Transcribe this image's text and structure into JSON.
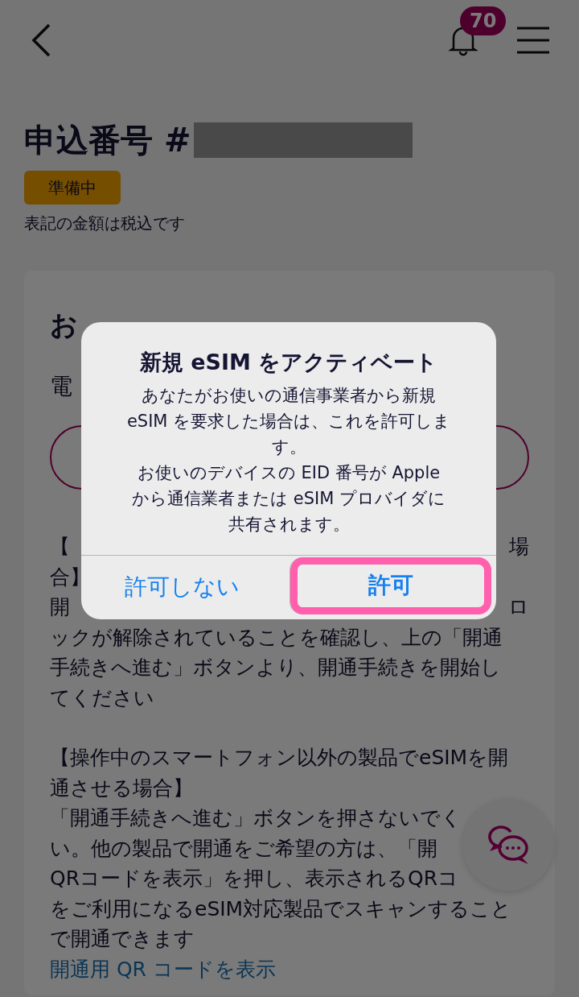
{
  "header": {
    "notification_count": "70"
  },
  "page_title": "申込番号 #",
  "status_badge": "準備中",
  "tax_note": "表記の金額は税込です",
  "card": {
    "title_fragment": "お",
    "label_fragment": "電",
    "paragraphs": [
      [
        {
          "left": "【",
          "right": "場"
        },
        {
          "left": "合】"
        },
        {
          "left": "開",
          "right": "ロ"
        },
        {
          "left": "ックが解除されていることを確認し、上の「開通"
        },
        {
          "left": "手続きへ進む」ボタンより、開通手続きを開始し"
        },
        {
          "left": "てください"
        }
      ],
      [
        {
          "left": "【操作中のスマートフォン以外の製品でeSIMを開"
        },
        {
          "left": "通させる場合】"
        },
        {
          "left": "「開通手続きへ進む」ボタンを押さないでく"
        },
        {
          "left": "い。他の製品で開通をご希望の方は、「開"
        },
        {
          "left": "QRコードを表示」を押し、表示されるQRコ"
        },
        {
          "left": "をご利用になるeSIM対応製品でスキャンすること"
        },
        {
          "left": "で開通できます"
        }
      ]
    ],
    "link": "開通用 QR コードを表示"
  },
  "dialog": {
    "title": "新規 eSIM をアクティベート",
    "message": [
      "あなたがお使いの通信事業者から新規 eSIM を要求した場合は、これを許可します。",
      "お使いのデバイスの EID 番号が Apple から通信業者または eSIM プロバイダに共有されます。"
    ],
    "buttons": [
      {
        "label": "許可しない",
        "bold": false,
        "highlighted": false
      },
      {
        "label": "許可",
        "bold": true,
        "highlighted": true
      }
    ]
  }
}
